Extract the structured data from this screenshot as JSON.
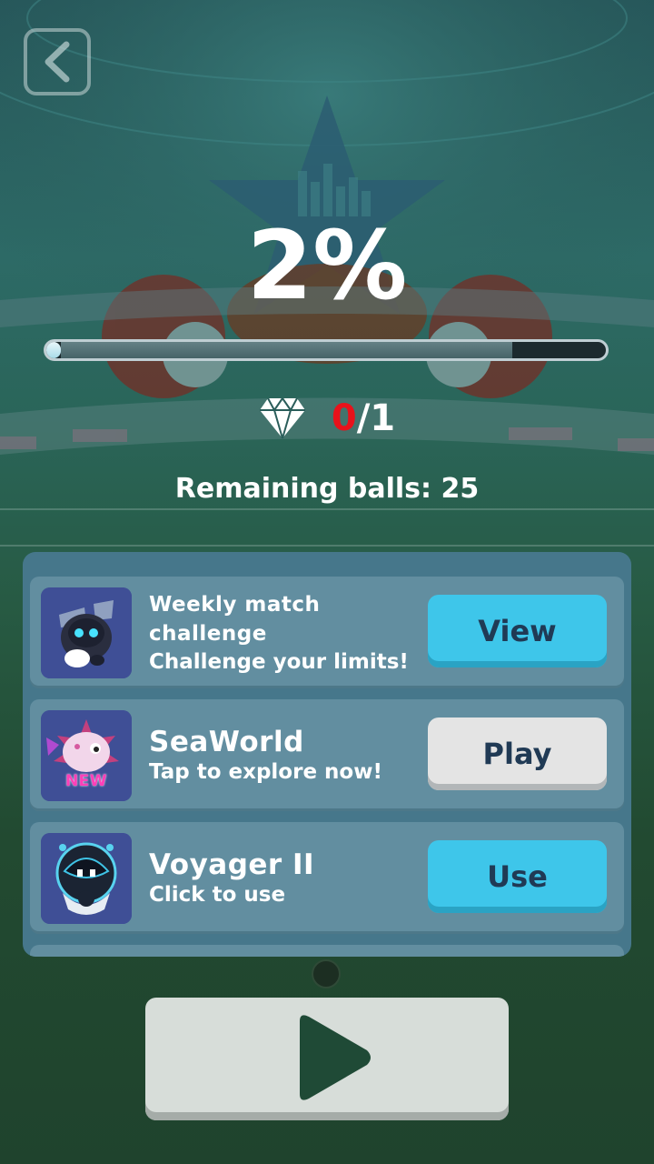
{
  "progress": {
    "percent_text": "2%",
    "fraction": 0.02
  },
  "gems": {
    "icon": "diamond-icon",
    "collected": "0",
    "separator": "/",
    "total": "1"
  },
  "remaining_balls_text": "Remaining balls: 25",
  "offers": [
    {
      "icon": "robot-character-icon",
      "title": "Weekly match challenge",
      "subtitle": "Challenge your limits!",
      "button_label": "View",
      "button_color": "#3ec6ea"
    },
    {
      "icon": "pufferfish-icon",
      "badge": "NEW",
      "title": "SeaWorld",
      "subtitle": "Tap to explore now!",
      "button_label": "Play",
      "button_color": "#e4e4e4"
    },
    {
      "icon": "robot-helmet-icon",
      "title": "Voyager II",
      "subtitle": "Click to use",
      "button_label": "Use",
      "button_color": "#3ec6ea"
    }
  ],
  "controls": {
    "back_icon": "chevron-left-icon",
    "play_icon": "play-icon"
  },
  "colors": {
    "accent_blue": "#3ec6ea",
    "gem_missing_red": "#e8121b",
    "panel": "#46778b"
  }
}
